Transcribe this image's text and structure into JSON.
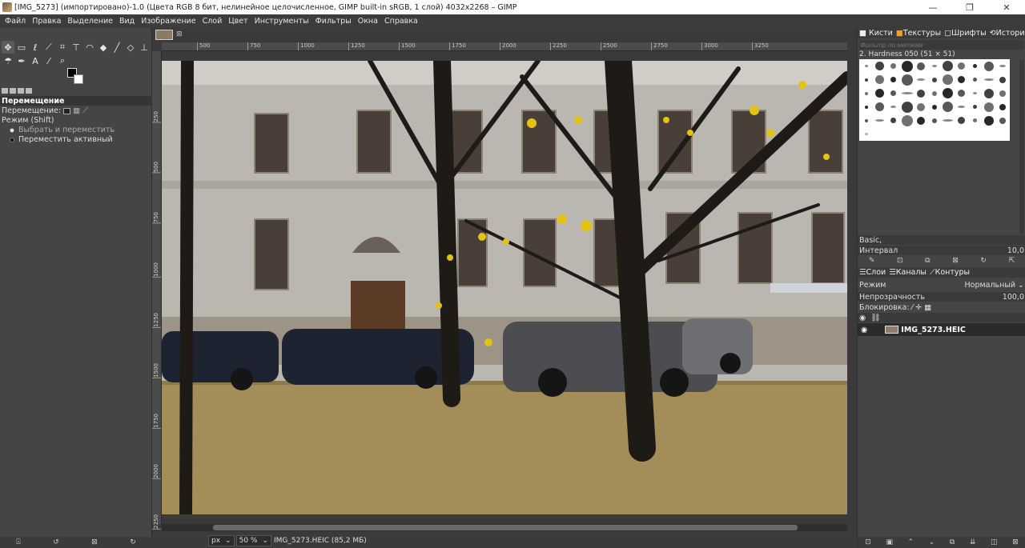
{
  "window": {
    "title": "[IMG_5273] (импортировано)-1.0 (Цвета RGB 8 бит, нелинейное целочисленное, GIMP built-in sRGB, 1 слой) 4032x2268 – GIMP",
    "minimize": "—",
    "maximize": "❐",
    "close": "✕"
  },
  "menu": [
    "Файл",
    "Правка",
    "Выделение",
    "Вид",
    "Изображение",
    "Слой",
    "Цвет",
    "Инструменты",
    "Фильтры",
    "Окна",
    "Справка"
  ],
  "tool_options": {
    "title": "Перемещение",
    "move_label": "Перемещение:",
    "mode_label": "Режим (Shift)",
    "option_1": "Выбрать и переместить",
    "option_2": "Переместить активный"
  },
  "ruler": {
    "h_ticks": [
      "500",
      "750",
      "1000",
      "1250",
      "1500",
      "1750",
      "2000",
      "2250",
      "2500",
      "2750",
      "3000",
      "3250"
    ],
    "v_ticks": [
      "250",
      "500",
      "750",
      "1000",
      "1250",
      "1500",
      "1750",
      "2000",
      "2250"
    ]
  },
  "status": {
    "unit": "px",
    "zoom": "50 %",
    "file_info": "IMG_5273.HEIC (85,2 МБ)"
  },
  "right_dock": {
    "tabs": [
      "Кисти",
      "Текстуры",
      "Шрифты",
      "История"
    ],
    "filter_placeholder": "Фильтр по меткам",
    "brush_name": "2. Hardness 050 (51 × 51)",
    "preset": "Basic,",
    "spacing_label": "Интервал",
    "spacing_value": "10,0",
    "layer_tabs": [
      "Слои",
      "Каналы",
      "Контуры"
    ],
    "mode_label": "Режим",
    "mode_value": "Нормальный",
    "opacity_label": "Непрозрачность",
    "opacity_value": "100,0",
    "lock_label": "Блокировка:",
    "layer_name": "IMG_5273.HEIC"
  }
}
